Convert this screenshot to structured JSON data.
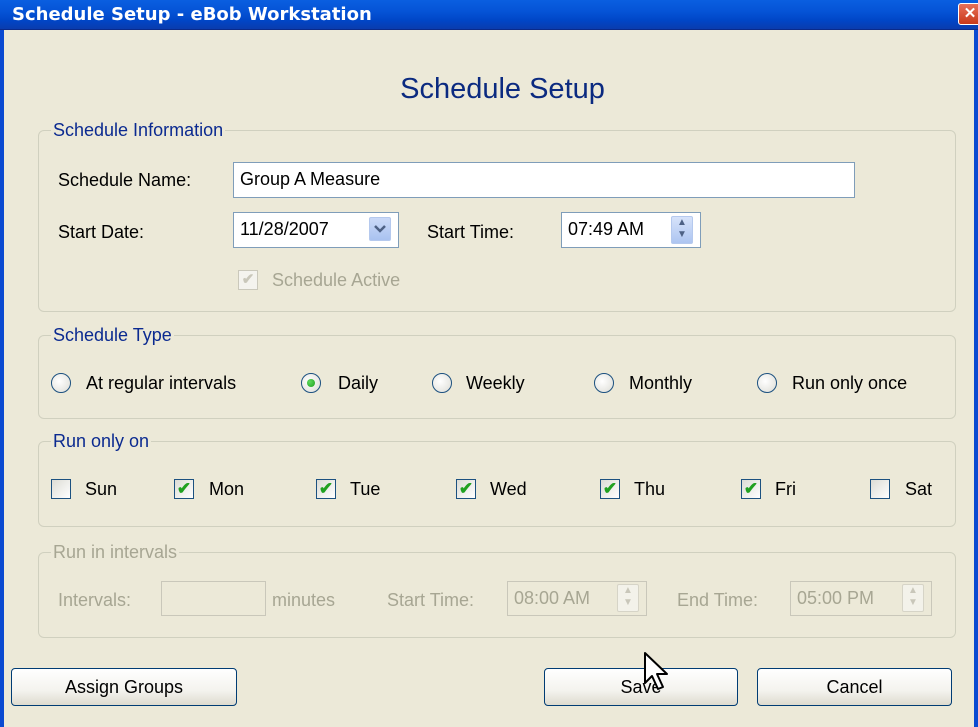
{
  "window": {
    "title": "Schedule Setup - eBob Workstation",
    "close_glyph": "✕"
  },
  "heading": "Schedule Setup",
  "schedule_info": {
    "legend": "Schedule Information",
    "name_label": "Schedule Name:",
    "name_value": "Group A Measure",
    "start_date_label": "Start Date:",
    "start_date_value": "11/28/2007",
    "start_time_label": "Start Time:",
    "start_time_value": "07:49 AM",
    "active_label": "Schedule Active",
    "active_checked": true,
    "active_enabled": false
  },
  "schedule_type": {
    "legend": "Schedule Type",
    "options": [
      {
        "label": "At regular intervals",
        "selected": false
      },
      {
        "label": "Daily",
        "selected": true
      },
      {
        "label": "Weekly",
        "selected": false
      },
      {
        "label": "Monthly",
        "selected": false
      },
      {
        "label": "Run only once",
        "selected": false
      }
    ]
  },
  "run_only_on": {
    "legend": "Run only on",
    "days": [
      {
        "label": "Sun",
        "checked": false
      },
      {
        "label": "Mon",
        "checked": true
      },
      {
        "label": "Tue",
        "checked": true
      },
      {
        "label": "Wed",
        "checked": true
      },
      {
        "label": "Thu",
        "checked": true
      },
      {
        "label": "Fri",
        "checked": true
      },
      {
        "label": "Sat",
        "checked": false
      }
    ]
  },
  "run_in_intervals": {
    "legend": "Run in intervals",
    "intervals_label": "Intervals:",
    "intervals_value": "",
    "minutes_label": "minutes",
    "start_time_label": "Start Time:",
    "start_time_value": "08:00 AM",
    "end_time_label": "End Time:",
    "end_time_value": "05:00 PM",
    "enabled": false
  },
  "buttons": {
    "assign_groups": "Assign Groups",
    "save": "Save",
    "cancel": "Cancel"
  },
  "icons": {
    "dropdown": "chevron-down-icon",
    "spin_up": "▲",
    "spin_down": "▼",
    "check": "✔"
  },
  "colors": {
    "titlebar": "#0553d6",
    "heading": "#0b2a80",
    "legend": "#0b2a90",
    "window_bg": "#ece9d8",
    "check_green": "#21a121"
  }
}
